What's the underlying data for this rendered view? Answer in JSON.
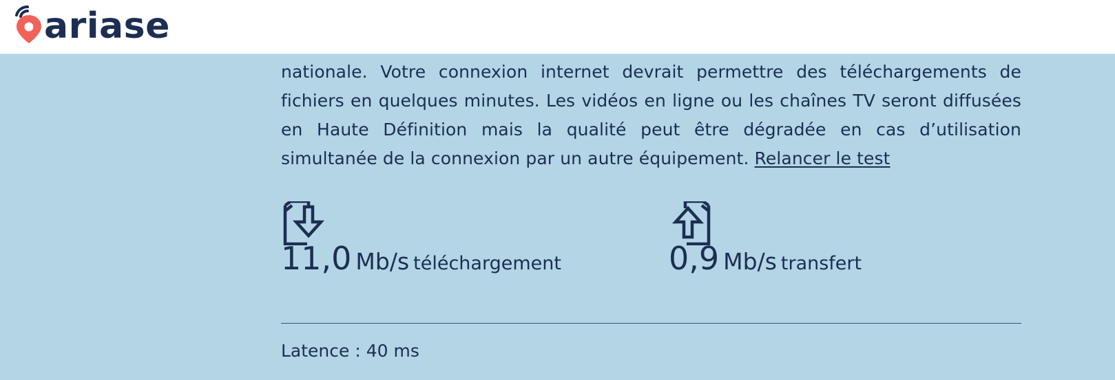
{
  "header": {
    "logo_text": "ariase",
    "colors": {
      "brand_pin": "#f0625a",
      "brand_text": "#1c2e52"
    }
  },
  "content": {
    "paragraph_text": "nationale. Votre connexion internet devrait permettre des téléchargements de fichiers en quelques minutes. Les vidéos en ligne ou les chaînes TV seront diffusées en Haute Définition mais la qualité peut être dégradée en cas d’utilisation simultanée de la connexion par un autre équipement. ",
    "retest_link": "Relancer le test"
  },
  "stats": {
    "download": {
      "icon": "download-file-icon",
      "value": "11,0",
      "unit": "Mb/s",
      "label": "téléchargement"
    },
    "upload": {
      "icon": "upload-file-icon",
      "value": "0,9",
      "unit": "Mb/s",
      "label": "transfert"
    }
  },
  "latency": {
    "text": "Latence : 40 ms"
  },
  "colors": {
    "background": "#b3d5e6",
    "text": "#1c2e52"
  }
}
